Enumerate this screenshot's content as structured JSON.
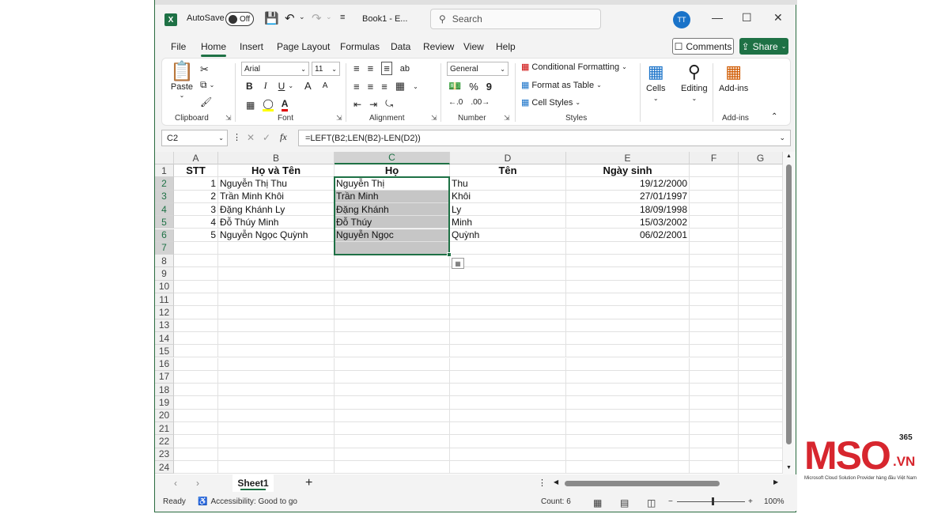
{
  "titlebar": {
    "autosave_label": "AutoSave",
    "autosave_state": "Off",
    "filename": "Book1 - E...",
    "search_placeholder": "Search",
    "avatar_initials": "TT"
  },
  "menu": {
    "tabs": [
      "File",
      "Home",
      "Insert",
      "Page Layout",
      "Formulas",
      "Data",
      "Review",
      "View",
      "Help"
    ],
    "active": "Home",
    "comments_label": "Comments",
    "share_label": "Share"
  },
  "ribbon": {
    "clipboard": {
      "paste": "Paste",
      "label": "Clipboard"
    },
    "font": {
      "family": "Arial",
      "size": "11",
      "bold": "B",
      "italic": "I",
      "underline": "U",
      "grow": "A",
      "shrink": "A",
      "color_letter": "A",
      "label": "Font"
    },
    "alignment": {
      "label": "Alignment"
    },
    "number": {
      "format": "General",
      "percent": "%",
      "comma": "9",
      "label": "Number"
    },
    "styles": {
      "conditional": "Conditional Formatting",
      "format_table": "Format as Table",
      "cell_styles": "Cell Styles",
      "label": "Styles"
    },
    "cells": {
      "label": "Cells"
    },
    "editing": {
      "label": "Editing"
    },
    "addins": {
      "button": "Add-ins",
      "label": "Add-ins"
    },
    "accent_color": "#1e7145"
  },
  "formula_bar": {
    "name_box": "C2",
    "fx": "fx",
    "formula": "=LEFT(B2;LEN(B2)-LEN(D2))"
  },
  "sheet": {
    "columns": [
      "A",
      "B",
      "C",
      "D",
      "E",
      "F",
      "G"
    ],
    "row_numbers": [
      "1",
      "2",
      "3",
      "4",
      "5",
      "6",
      "7",
      "8",
      "9",
      "10",
      "11",
      "12",
      "13",
      "14",
      "15",
      "16",
      "17",
      "18",
      "19",
      "20",
      "21",
      "22",
      "23",
      "24"
    ],
    "header_row": [
      "STT",
      "Họ và Tên",
      "Họ",
      "Tên",
      "Ngày sinh"
    ],
    "rows": [
      [
        "1",
        "Nguyễn Thị Thu",
        "Nguyễn Thị",
        "Thu",
        "19/12/2000"
      ],
      [
        "2",
        "Trần Minh Khôi",
        "Trần Minh",
        "Khôi",
        "27/01/1997"
      ],
      [
        "3",
        "Đặng Khánh Ly",
        "Đặng Khánh",
        "Ly",
        "18/09/1998"
      ],
      [
        "4",
        "Đỗ Thúy Minh",
        "Đỗ Thúy",
        "Minh",
        "15/03/2002"
      ],
      [
        "5",
        "Nguyễn Ngọc Quỳnh",
        "Nguyễn Ngọc",
        "Quỳnh",
        "06/02/2001"
      ]
    ],
    "selected_column": "C"
  },
  "tabs": {
    "sheet_name": "Sheet1",
    "add": "+"
  },
  "status": {
    "ready": "Ready",
    "accessibility": "Accessibility: Good to go",
    "count": "Count: 6",
    "zoom": "100%",
    "zoom_minus": "−",
    "zoom_plus": "+"
  },
  "logo": {
    "main": "MSO",
    "suffix": ".VN",
    "badge": "365",
    "tagline": "Microsoft Cloud Solution Provider hàng đầu Việt Nam",
    "color": "#d7262e"
  }
}
